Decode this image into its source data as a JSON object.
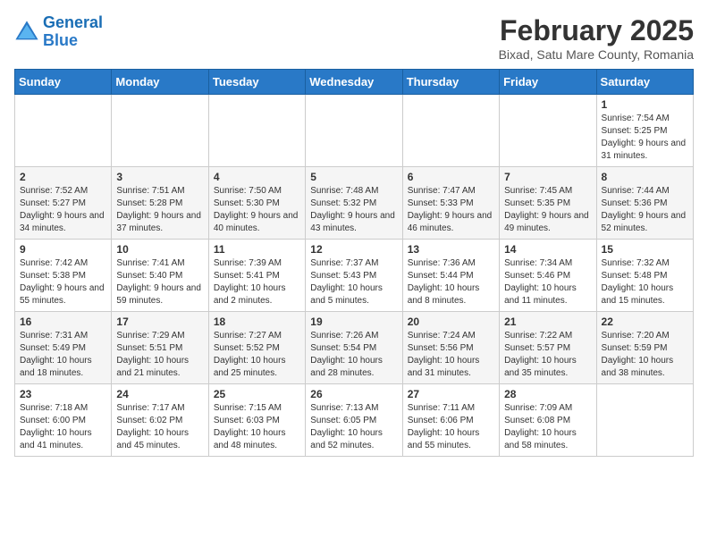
{
  "header": {
    "logo_line1": "General",
    "logo_line2": "Blue",
    "month_title": "February 2025",
    "subtitle": "Bixad, Satu Mare County, Romania"
  },
  "weekdays": [
    "Sunday",
    "Monday",
    "Tuesday",
    "Wednesday",
    "Thursday",
    "Friday",
    "Saturday"
  ],
  "weeks": [
    [
      {
        "day": "",
        "info": ""
      },
      {
        "day": "",
        "info": ""
      },
      {
        "day": "",
        "info": ""
      },
      {
        "day": "",
        "info": ""
      },
      {
        "day": "",
        "info": ""
      },
      {
        "day": "",
        "info": ""
      },
      {
        "day": "1",
        "info": "Sunrise: 7:54 AM\nSunset: 5:25 PM\nDaylight: 9 hours and 31 minutes."
      }
    ],
    [
      {
        "day": "2",
        "info": "Sunrise: 7:52 AM\nSunset: 5:27 PM\nDaylight: 9 hours and 34 minutes."
      },
      {
        "day": "3",
        "info": "Sunrise: 7:51 AM\nSunset: 5:28 PM\nDaylight: 9 hours and 37 minutes."
      },
      {
        "day": "4",
        "info": "Sunrise: 7:50 AM\nSunset: 5:30 PM\nDaylight: 9 hours and 40 minutes."
      },
      {
        "day": "5",
        "info": "Sunrise: 7:48 AM\nSunset: 5:32 PM\nDaylight: 9 hours and 43 minutes."
      },
      {
        "day": "6",
        "info": "Sunrise: 7:47 AM\nSunset: 5:33 PM\nDaylight: 9 hours and 46 minutes."
      },
      {
        "day": "7",
        "info": "Sunrise: 7:45 AM\nSunset: 5:35 PM\nDaylight: 9 hours and 49 minutes."
      },
      {
        "day": "8",
        "info": "Sunrise: 7:44 AM\nSunset: 5:36 PM\nDaylight: 9 hours and 52 minutes."
      }
    ],
    [
      {
        "day": "9",
        "info": "Sunrise: 7:42 AM\nSunset: 5:38 PM\nDaylight: 9 hours and 55 minutes."
      },
      {
        "day": "10",
        "info": "Sunrise: 7:41 AM\nSunset: 5:40 PM\nDaylight: 9 hours and 59 minutes."
      },
      {
        "day": "11",
        "info": "Sunrise: 7:39 AM\nSunset: 5:41 PM\nDaylight: 10 hours and 2 minutes."
      },
      {
        "day": "12",
        "info": "Sunrise: 7:37 AM\nSunset: 5:43 PM\nDaylight: 10 hours and 5 minutes."
      },
      {
        "day": "13",
        "info": "Sunrise: 7:36 AM\nSunset: 5:44 PM\nDaylight: 10 hours and 8 minutes."
      },
      {
        "day": "14",
        "info": "Sunrise: 7:34 AM\nSunset: 5:46 PM\nDaylight: 10 hours and 11 minutes."
      },
      {
        "day": "15",
        "info": "Sunrise: 7:32 AM\nSunset: 5:48 PM\nDaylight: 10 hours and 15 minutes."
      }
    ],
    [
      {
        "day": "16",
        "info": "Sunrise: 7:31 AM\nSunset: 5:49 PM\nDaylight: 10 hours and 18 minutes."
      },
      {
        "day": "17",
        "info": "Sunrise: 7:29 AM\nSunset: 5:51 PM\nDaylight: 10 hours and 21 minutes."
      },
      {
        "day": "18",
        "info": "Sunrise: 7:27 AM\nSunset: 5:52 PM\nDaylight: 10 hours and 25 minutes."
      },
      {
        "day": "19",
        "info": "Sunrise: 7:26 AM\nSunset: 5:54 PM\nDaylight: 10 hours and 28 minutes."
      },
      {
        "day": "20",
        "info": "Sunrise: 7:24 AM\nSunset: 5:56 PM\nDaylight: 10 hours and 31 minutes."
      },
      {
        "day": "21",
        "info": "Sunrise: 7:22 AM\nSunset: 5:57 PM\nDaylight: 10 hours and 35 minutes."
      },
      {
        "day": "22",
        "info": "Sunrise: 7:20 AM\nSunset: 5:59 PM\nDaylight: 10 hours and 38 minutes."
      }
    ],
    [
      {
        "day": "23",
        "info": "Sunrise: 7:18 AM\nSunset: 6:00 PM\nDaylight: 10 hours and 41 minutes."
      },
      {
        "day": "24",
        "info": "Sunrise: 7:17 AM\nSunset: 6:02 PM\nDaylight: 10 hours and 45 minutes."
      },
      {
        "day": "25",
        "info": "Sunrise: 7:15 AM\nSunset: 6:03 PM\nDaylight: 10 hours and 48 minutes."
      },
      {
        "day": "26",
        "info": "Sunrise: 7:13 AM\nSunset: 6:05 PM\nDaylight: 10 hours and 52 minutes."
      },
      {
        "day": "27",
        "info": "Sunrise: 7:11 AM\nSunset: 6:06 PM\nDaylight: 10 hours and 55 minutes."
      },
      {
        "day": "28",
        "info": "Sunrise: 7:09 AM\nSunset: 6:08 PM\nDaylight: 10 hours and 58 minutes."
      },
      {
        "day": "",
        "info": ""
      }
    ]
  ]
}
